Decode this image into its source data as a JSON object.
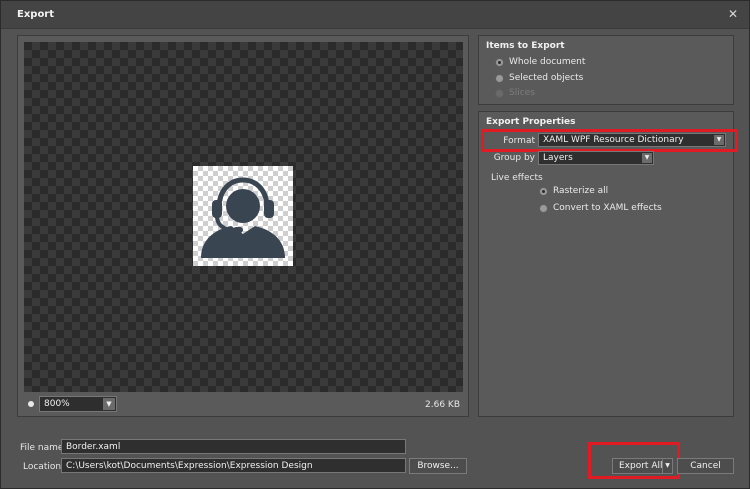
{
  "window": {
    "title": "Export"
  },
  "preview": {
    "zoom": "800%",
    "file_size": "2.66 KB",
    "thumbnail_icon": "headset-person-icon"
  },
  "items_to_export": {
    "title": "Items to Export",
    "options": [
      {
        "label": "Whole document",
        "checked": true,
        "enabled": true
      },
      {
        "label": "Selected objects",
        "checked": false,
        "enabled": true
      },
      {
        "label": "Slices",
        "checked": false,
        "enabled": false
      }
    ]
  },
  "export_properties": {
    "title": "Export Properties",
    "format_label": "Format",
    "format_value": "XAML WPF Resource Dictionary",
    "group_by_label": "Group by",
    "group_by_value": "Layers",
    "live_effects_label": "Live effects",
    "live_effects_options": [
      {
        "label": "Rasterize all",
        "checked": true
      },
      {
        "label": "Convert to XAML effects",
        "checked": false
      }
    ]
  },
  "file": {
    "name_label": "File name",
    "name_value": "Border.xaml",
    "location_label": "Location",
    "location_value": "C:\\Users\\kot\\Documents\\Expression\\Expression Design",
    "browse_label": "Browse..."
  },
  "actions": {
    "export_all_label": "Export All",
    "cancel_label": "Cancel"
  },
  "colors": {
    "highlight": "#e01b24",
    "icon": "#3a4552"
  }
}
